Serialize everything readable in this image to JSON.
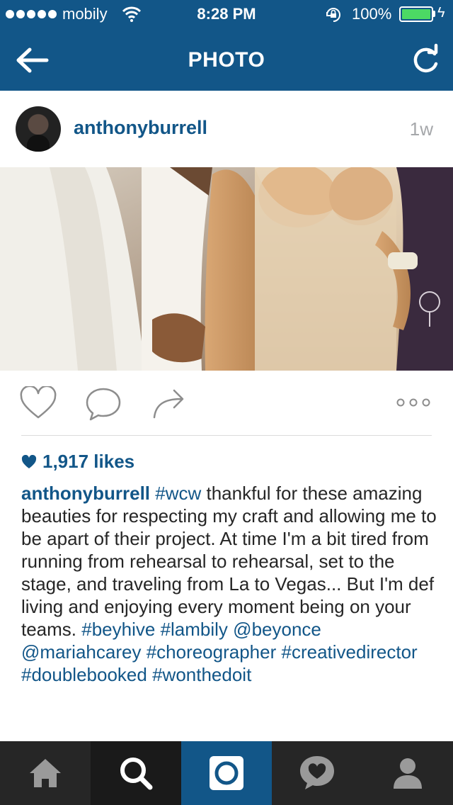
{
  "status_bar": {
    "carrier": "mobily",
    "time": "8:28 PM",
    "battery": "100%",
    "signal_icon": "signal-dots-icon",
    "wifi_icon": "wifi-icon",
    "lock_icon": "rotation-lock-icon",
    "charging_icon": "bolt-icon"
  },
  "nav": {
    "title": "PHOTO",
    "back_icon": "back-arrow-icon",
    "refresh_icon": "refresh-icon"
  },
  "post": {
    "username": "anthonyburrell",
    "time_ago": "1w",
    "likes": "1,917 likes",
    "caption": {
      "user": "anthonyburrell",
      "segments": [
        {
          "text": "#wcw",
          "type": "tag"
        },
        {
          "text": " thankful for these amazing beauties for respecting my craft and allowing me to be apart of their project. At time I'm a bit tired from running from rehearsal to rehearsal, set to the stage, and traveling from La to Vegas... But I'm def living and enjoying every moment being on your teams. ",
          "type": "text"
        },
        {
          "text": "#beyhive",
          "type": "tag"
        },
        {
          "text": " ",
          "type": "text"
        },
        {
          "text": "#lambily",
          "type": "tag"
        },
        {
          "text": " ",
          "type": "text"
        },
        {
          "text": "@beyonce",
          "type": "tag"
        },
        {
          "text": " ",
          "type": "text"
        },
        {
          "text": "@mariahcarey",
          "type": "tag"
        },
        {
          "text": " ",
          "type": "text"
        },
        {
          "text": "#choreographer",
          "type": "tag"
        },
        {
          "text": " ",
          "type": "text"
        },
        {
          "text": "#creativedirector",
          "type": "tag"
        },
        {
          "text": " ",
          "type": "text"
        },
        {
          "text": "#doublebooked",
          "type": "tag"
        },
        {
          "text": " ",
          "type": "text"
        },
        {
          "text": "#wonthedoit",
          "type": "tag"
        }
      ]
    }
  },
  "actions": {
    "like_icon": "heart-outline-icon",
    "comment_icon": "comment-bubble-icon",
    "share_icon": "share-arrow-icon",
    "more_icon": "more-dots-icon"
  },
  "tabbar": {
    "tabs": [
      {
        "icon": "home-icon",
        "active": false
      },
      {
        "icon": "search-icon",
        "active": false
      },
      {
        "icon": "camera-icon",
        "active": true
      },
      {
        "icon": "activity-heart-icon",
        "active": false
      },
      {
        "icon": "profile-icon",
        "active": false
      }
    ]
  },
  "colors": {
    "brand": "#125688",
    "tabbar": "#262626",
    "text": "#262626",
    "muted": "#a5a7aa",
    "battery": "#4cd964"
  }
}
